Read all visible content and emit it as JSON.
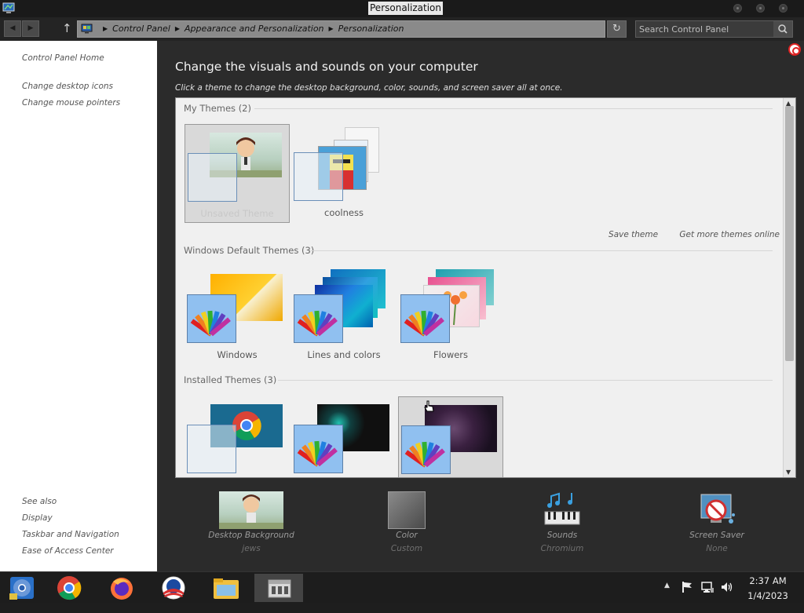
{
  "window": {
    "title": "Personalization"
  },
  "navbar": {
    "back_label": "◀",
    "forward_label": "▶",
    "up_label": "↑",
    "breadcrumbs": [
      "Control Panel",
      "Appearance and Personalization",
      "Personalization"
    ],
    "refresh_label": "↻",
    "search_placeholder": "Search Control Panel"
  },
  "sidebar": {
    "home": "Control Panel Home",
    "links": [
      "Change desktop icons",
      "Change mouse pointers"
    ],
    "see_also": "See also",
    "see_also_links": [
      "Display",
      "Taskbar and Navigation",
      "Ease of Access Center"
    ]
  },
  "main": {
    "heading": "Change the visuals and sounds on your computer",
    "subheading": "Click a theme to change the desktop background, color, sounds, and screen saver all at once.",
    "groups": {
      "my_themes": "My Themes (2)",
      "windows_default": "Windows Default Themes (3)",
      "installed": "Installed Themes (3)"
    },
    "my_themes": [
      "Unsaved Theme",
      "coolness"
    ],
    "default_themes": [
      "Windows",
      "Lines and colors",
      "Flowers"
    ],
    "save_theme": "Save theme",
    "get_more": "Get more themes online"
  },
  "bottom": {
    "desktop_background": {
      "name": "Desktop Background",
      "value": "jews"
    },
    "color": {
      "name": "Color",
      "value": "Custom"
    },
    "sounds": {
      "name": "Sounds",
      "value": "Chromium"
    },
    "screen_saver": {
      "name": "Screen Saver",
      "value": "None"
    }
  },
  "taskbar": {
    "apps": [
      "chromium-icon",
      "chrome-icon",
      "firefox-icon",
      "obama-logo-icon",
      "file-explorer-icon",
      "control-panel-icon"
    ],
    "tray_chevron": "▲",
    "time": "2:37 AM",
    "date": "1/4/2023"
  },
  "colors": {
    "accent_blue": "#90c0f0",
    "window_bg": "#2b2b2b",
    "panel_bg": "#f0f0f0"
  }
}
